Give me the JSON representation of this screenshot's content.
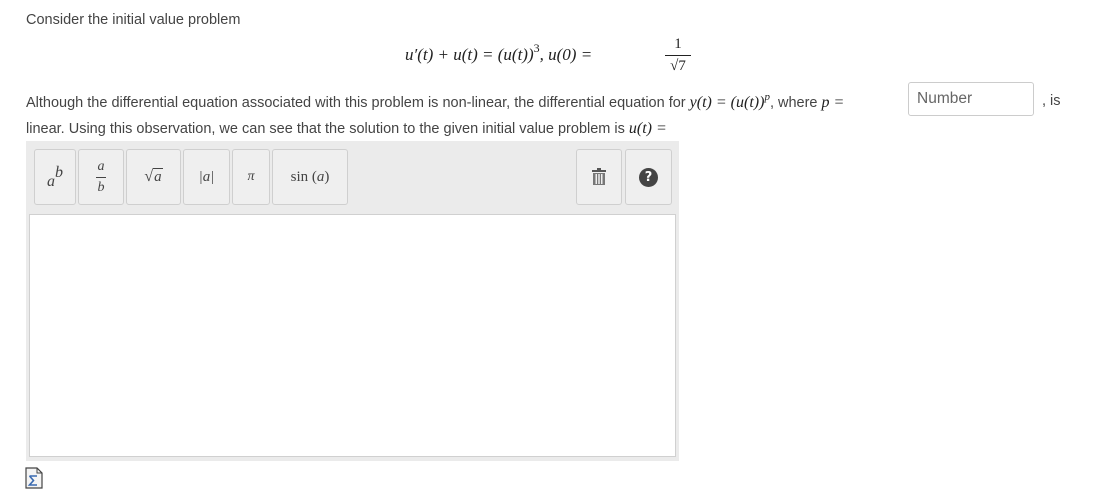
{
  "problem": {
    "intro": "Consider the initial value problem",
    "equation_lhs": "u′(t) + u(t) = (u(t))",
    "equation_exponent": "3",
    "initial_condition": ",   u(0) =",
    "ic_numerator": "1",
    "ic_denominator": "√7",
    "line2_text_a": "Although the differential equation associated with this problem is non-linear, the differential equation for ",
    "line2_math_a": "y(t) = (u(t))",
    "line2_math_exp": "p",
    "line2_text_b": ", where ",
    "line2_math_b": "p =",
    "line3_text": "linear. Using this observation, we can see that the solution to the given initial value problem is ",
    "line3_math": "u(t) =",
    "is_suffix": ", is"
  },
  "p_input": {
    "placeholder": "Number",
    "value": ""
  },
  "toolbar": {
    "power_base": "a",
    "power_exp": "b",
    "frac_num": "a",
    "frac_den": "b",
    "sqrt_label": "√",
    "sqrt_arg": "a",
    "abs_label": "|a|",
    "pi_label": "π",
    "sin_label": "sin (",
    "sin_arg": "a",
    "sin_close": ")"
  },
  "icons": {
    "trash": "trash-icon",
    "help": "help-icon",
    "help_glyph": "?",
    "equation_editor": "sigma-icon"
  }
}
